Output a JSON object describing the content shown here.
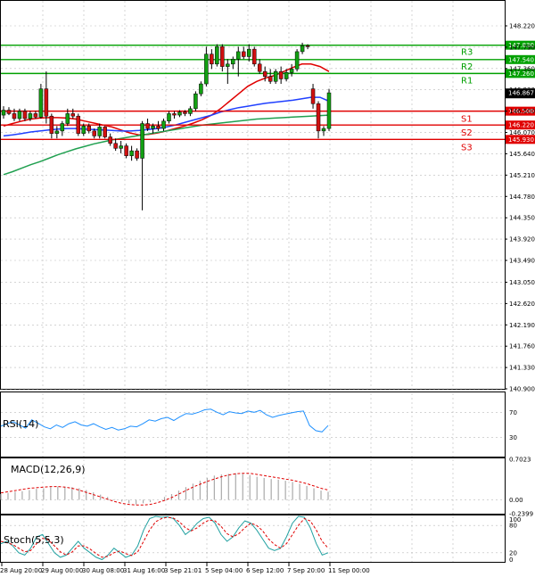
{
  "chart_data": [
    {
      "type": "candlestick",
      "panel": "price",
      "price_axis": {
        "ticks": [
          "148.220",
          "147.790",
          "147.360",
          "146.930",
          "146.500",
          "146.070",
          "145.640",
          "145.210",
          "144.780",
          "144.350",
          "143.920",
          "143.490",
          "143.050",
          "142.620",
          "142.190",
          "141.760",
          "141.330",
          "140.900"
        ],
        "ylim": [
          140.9,
          148.22
        ]
      },
      "last_price": "146.867",
      "levels": [
        {
          "name": "R3",
          "value": "147.830",
          "color": "#00a000"
        },
        {
          "name": "R2",
          "value": "147.540",
          "color": "#00a000"
        },
        {
          "name": "R1",
          "value": "147.260",
          "color": "#00a000"
        },
        {
          "name": "S1",
          "value": "146.500",
          "color": "#e00000"
        },
        {
          "name": "S2",
          "value": "146.220",
          "color": "#e00000"
        },
        {
          "name": "S3",
          "value": "145.930",
          "color": "#e00000"
        }
      ],
      "time_labels": [
        "28 Aug 20:00",
        "29 Aug 00:00",
        "30 Aug 08:00",
        "31 Aug 16:00",
        "3 Sep 21:01",
        "5 Sep 04:00",
        "6 Sep 12:00",
        "7 Sep 20:00",
        "11 Sep 00:00"
      ],
      "candles": [
        {
          "o": 146.42,
          "h": 146.6,
          "l": 146.35,
          "c": 146.52
        },
        {
          "o": 146.52,
          "h": 146.58,
          "l": 146.42,
          "c": 146.45
        },
        {
          "o": 146.45,
          "h": 146.55,
          "l": 146.3,
          "c": 146.35
        },
        {
          "o": 146.35,
          "h": 146.55,
          "l": 146.3,
          "c": 146.5
        },
        {
          "o": 146.5,
          "h": 146.55,
          "l": 146.3,
          "c": 146.35
        },
        {
          "o": 146.35,
          "h": 146.5,
          "l": 146.3,
          "c": 146.45
        },
        {
          "o": 146.45,
          "h": 146.5,
          "l": 146.35,
          "c": 146.38
        },
        {
          "o": 146.38,
          "h": 147.05,
          "l": 146.35,
          "c": 146.95
        },
        {
          "o": 146.95,
          "h": 147.3,
          "l": 146.25,
          "c": 146.4
        },
        {
          "o": 146.4,
          "h": 146.45,
          "l": 145.95,
          "c": 146.05
        },
        {
          "o": 146.05,
          "h": 146.2,
          "l": 145.95,
          "c": 146.1
        },
        {
          "o": 146.1,
          "h": 146.3,
          "l": 146.0,
          "c": 146.25
        },
        {
          "o": 146.25,
          "h": 146.55,
          "l": 146.2,
          "c": 146.45
        },
        {
          "o": 146.45,
          "h": 146.55,
          "l": 146.35,
          "c": 146.4
        },
        {
          "o": 146.4,
          "h": 146.45,
          "l": 146.0,
          "c": 146.05
        },
        {
          "o": 146.05,
          "h": 146.25,
          "l": 146.0,
          "c": 146.2
        },
        {
          "o": 146.2,
          "h": 146.25,
          "l": 146.05,
          "c": 146.1
        },
        {
          "o": 146.1,
          "h": 146.15,
          "l": 145.95,
          "c": 146.0
        },
        {
          "o": 146.0,
          "h": 146.25,
          "l": 145.95,
          "c": 146.18
        },
        {
          "o": 146.18,
          "h": 146.2,
          "l": 145.95,
          "c": 145.98
        },
        {
          "o": 145.98,
          "h": 146.05,
          "l": 145.8,
          "c": 145.85
        },
        {
          "o": 145.85,
          "h": 145.95,
          "l": 145.7,
          "c": 145.75
        },
        {
          "o": 145.75,
          "h": 145.9,
          "l": 145.65,
          "c": 145.8
        },
        {
          "o": 145.8,
          "h": 145.85,
          "l": 145.55,
          "c": 145.6
        },
        {
          "o": 145.6,
          "h": 145.8,
          "l": 145.5,
          "c": 145.7
        },
        {
          "o": 145.7,
          "h": 145.75,
          "l": 145.5,
          "c": 145.55
        },
        {
          "o": 145.55,
          "h": 146.3,
          "l": 144.5,
          "c": 146.25
        },
        {
          "o": 146.25,
          "h": 146.35,
          "l": 146.1,
          "c": 146.15
        },
        {
          "o": 146.15,
          "h": 146.25,
          "l": 146.05,
          "c": 146.2
        },
        {
          "o": 146.2,
          "h": 146.3,
          "l": 146.1,
          "c": 146.15
        },
        {
          "o": 146.15,
          "h": 146.35,
          "l": 146.1,
          "c": 146.3
        },
        {
          "o": 146.3,
          "h": 146.5,
          "l": 146.25,
          "c": 146.45
        },
        {
          "o": 146.45,
          "h": 146.5,
          "l": 146.35,
          "c": 146.42
        },
        {
          "o": 146.42,
          "h": 146.52,
          "l": 146.38,
          "c": 146.48
        },
        {
          "o": 146.48,
          "h": 146.52,
          "l": 146.4,
          "c": 146.45
        },
        {
          "o": 146.45,
          "h": 146.6,
          "l": 146.4,
          "c": 146.55
        },
        {
          "o": 146.55,
          "h": 146.9,
          "l": 146.5,
          "c": 146.85
        },
        {
          "o": 146.85,
          "h": 147.1,
          "l": 146.8,
          "c": 147.05
        },
        {
          "o": 147.05,
          "h": 147.8,
          "l": 147.0,
          "c": 147.65
        },
        {
          "o": 147.65,
          "h": 147.75,
          "l": 147.35,
          "c": 147.45
        },
        {
          "o": 147.45,
          "h": 147.85,
          "l": 147.4,
          "c": 147.8
        },
        {
          "o": 147.8,
          "h": 147.85,
          "l": 147.3,
          "c": 147.4
        },
        {
          "o": 147.4,
          "h": 147.55,
          "l": 147.05,
          "c": 147.45
        },
        {
          "o": 147.45,
          "h": 147.6,
          "l": 147.35,
          "c": 147.55
        },
        {
          "o": 147.55,
          "h": 147.8,
          "l": 147.2,
          "c": 147.7
        },
        {
          "o": 147.7,
          "h": 147.8,
          "l": 147.55,
          "c": 147.6
        },
        {
          "o": 147.6,
          "h": 147.85,
          "l": 147.5,
          "c": 147.75
        },
        {
          "o": 147.75,
          "h": 147.8,
          "l": 147.4,
          "c": 147.45
        },
        {
          "o": 147.45,
          "h": 147.55,
          "l": 147.25,
          "c": 147.3
        },
        {
          "o": 147.3,
          "h": 147.4,
          "l": 147.1,
          "c": 147.2
        },
        {
          "o": 147.2,
          "h": 147.35,
          "l": 147.05,
          "c": 147.1
        },
        {
          "o": 147.1,
          "h": 147.35,
          "l": 147.05,
          "c": 147.3
        },
        {
          "o": 147.3,
          "h": 147.4,
          "l": 147.05,
          "c": 147.15
        },
        {
          "o": 147.15,
          "h": 147.35,
          "l": 147.1,
          "c": 147.28
        },
        {
          "o": 147.28,
          "h": 147.45,
          "l": 147.2,
          "c": 147.35
        },
        {
          "o": 147.35,
          "h": 147.75,
          "l": 147.3,
          "c": 147.7
        },
        {
          "o": 147.7,
          "h": 147.88,
          "l": 147.65,
          "c": 147.82
        },
        {
          "o": 147.82,
          "h": 147.85,
          "l": 147.75,
          "c": 147.8
        },
        {
          "o": 146.95,
          "h": 147.05,
          "l": 146.55,
          "c": 146.65
        },
        {
          "o": 146.65,
          "h": 146.7,
          "l": 145.95,
          "c": 146.1
        },
        {
          "o": 146.1,
          "h": 146.2,
          "l": 146.0,
          "c": 146.15
        },
        {
          "o": 146.15,
          "h": 146.95,
          "l": 146.1,
          "c": 146.87
        }
      ],
      "moving_averages": [
        {
          "color": "#e00000",
          "points": [
            146.2,
            146.25,
            146.3,
            146.34,
            146.36,
            146.37,
            146.37,
            146.36,
            146.34,
            146.3,
            146.26,
            146.22,
            146.18,
            146.12,
            146.06,
            146.02,
            146.03,
            146.06,
            146.1,
            146.15,
            146.2,
            146.26,
            146.33,
            146.42,
            146.55,
            146.7,
            146.85,
            147.0,
            147.1,
            147.17,
            147.22,
            147.3,
            147.38,
            147.45,
            147.45,
            147.4,
            147.3
          ]
        },
        {
          "color": "#2040ff",
          "points": [
            146.0,
            146.02,
            146.05,
            146.08,
            146.1,
            146.12,
            146.14,
            146.15,
            146.15,
            146.14,
            146.13,
            146.12,
            146.11,
            146.1,
            146.1,
            146.11,
            146.13,
            146.15,
            146.18,
            146.22,
            146.27,
            146.32,
            146.37,
            146.42,
            146.48,
            146.53,
            146.57,
            146.6,
            146.63,
            146.66,
            146.68,
            146.7,
            146.72,
            146.75,
            146.78,
            146.78,
            146.7
          ]
        },
        {
          "color": "#20a050",
          "points": [
            145.22,
            145.28,
            145.35,
            145.42,
            145.48,
            145.55,
            145.62,
            145.68,
            145.74,
            145.79,
            145.84,
            145.88,
            145.92,
            145.95,
            145.98,
            146.01,
            146.04,
            146.07,
            146.1,
            146.13,
            146.16,
            146.19,
            146.22,
            146.24,
            146.26,
            146.28,
            146.3,
            146.32,
            146.34,
            146.35,
            146.36,
            146.37,
            146.38,
            146.39,
            146.4,
            146.41,
            146.42
          ]
        }
      ]
    },
    {
      "type": "line",
      "panel": "rsi",
      "title": "RSI(14)",
      "ticks": [
        "70",
        "30"
      ],
      "ylim": [
        0,
        100
      ],
      "values": [
        48,
        52,
        55,
        50,
        45,
        58,
        53,
        47,
        44,
        50,
        46,
        52,
        55,
        50,
        48,
        52,
        47,
        43,
        46,
        42,
        44,
        48,
        47,
        52,
        58,
        56,
        60,
        62,
        57,
        63,
        68,
        67,
        70,
        74,
        75,
        70,
        66,
        71,
        69,
        68,
        72,
        70,
        73,
        66,
        62,
        65,
        67,
        69,
        71,
        72,
        49,
        41,
        39,
        49
      ]
    },
    {
      "type": "histogram+line",
      "panel": "macd",
      "title": "MACD(12,26,9)",
      "ticks": [
        "0.7023",
        "0.00",
        "-0.2399"
      ],
      "ylim": [
        -0.2399,
        0.7023
      ],
      "histogram": [
        0.1,
        0.12,
        0.14,
        0.15,
        0.17,
        0.19,
        0.2,
        0.22,
        0.23,
        0.23,
        0.22,
        0.2,
        0.17,
        0.13,
        0.09,
        0.05,
        0.01,
        -0.03,
        -0.06,
        -0.08,
        -0.06,
        -0.04,
        0.0,
        0.05,
        0.1,
        0.16,
        0.22,
        0.28,
        0.33,
        0.38,
        0.42,
        0.44,
        0.45,
        0.46,
        0.45,
        0.43,
        0.4,
        0.38,
        0.36,
        0.35,
        0.33,
        0.31,
        0.28,
        0.24,
        0.2,
        0.16,
        0.14
      ],
      "signal": [
        0.12,
        0.14,
        0.16,
        0.18,
        0.2,
        0.21,
        0.22,
        0.23,
        0.23,
        0.22,
        0.2,
        0.17,
        0.13,
        0.09,
        0.05,
        0.01,
        -0.03,
        -0.06,
        -0.08,
        -0.09,
        -0.09,
        -0.08,
        -0.05,
        -0.01,
        0.04,
        0.1,
        0.16,
        0.22,
        0.27,
        0.32,
        0.36,
        0.4,
        0.43,
        0.45,
        0.46,
        0.46,
        0.44,
        0.42,
        0.4,
        0.38,
        0.36,
        0.34,
        0.31,
        0.28,
        0.24,
        0.2,
        0.17
      ]
    },
    {
      "type": "line",
      "panel": "stoch",
      "title": "Stoch(5,5,3)",
      "ticks": [
        "100",
        "80",
        "20",
        "0"
      ],
      "ylim": [
        0,
        100
      ],
      "k": [
        40,
        45,
        35,
        20,
        15,
        30,
        55,
        60,
        40,
        20,
        10,
        15,
        30,
        45,
        30,
        20,
        10,
        5,
        15,
        30,
        20,
        10,
        15,
        35,
        70,
        95,
        100,
        98,
        99,
        95,
        80,
        60,
        70,
        85,
        95,
        98,
        85,
        60,
        45,
        55,
        75,
        90,
        85,
        70,
        50,
        30,
        25,
        30,
        55,
        85,
        100,
        98,
        75,
        40,
        15,
        20
      ],
      "d": [
        45,
        42,
        38,
        30,
        22,
        25,
        40,
        52,
        48,
        35,
        22,
        15,
        22,
        35,
        35,
        28,
        18,
        10,
        12,
        20,
        24,
        18,
        14,
        22,
        45,
        70,
        88,
        95,
        98,
        96,
        88,
        75,
        68,
        75,
        85,
        92,
        90,
        78,
        62,
        55,
        62,
        75,
        85,
        80,
        68,
        50,
        38,
        30,
        40,
        60,
        80,
        95,
        90,
        70,
        45,
        30
      ]
    }
  ]
}
